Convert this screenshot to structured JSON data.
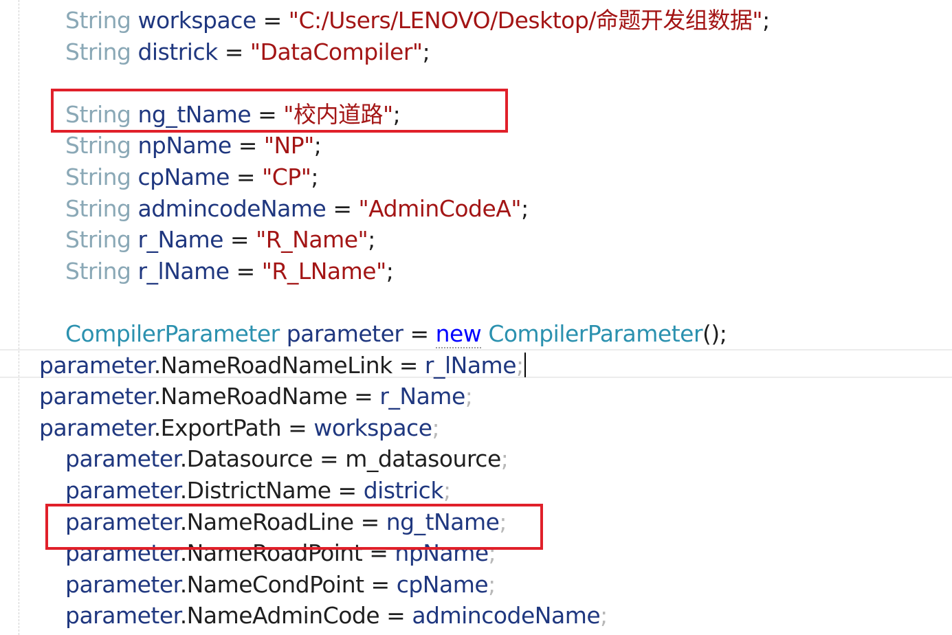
{
  "code": {
    "lines": [
      {
        "indent": "inner",
        "parts": [
          [
            "type",
            "String"
          ],
          [
            "plain",
            " "
          ],
          [
            "ident",
            "workspace"
          ],
          [
            "plain",
            " = "
          ],
          [
            "str",
            "\"C:/Users/LENOVO/Desktop/命题开发组数据\""
          ],
          [
            "plain",
            ";"
          ]
        ]
      },
      {
        "indent": "inner",
        "parts": [
          [
            "type",
            "String"
          ],
          [
            "plain",
            " "
          ],
          [
            "ident",
            "districk"
          ],
          [
            "plain",
            " = "
          ],
          [
            "str",
            "\"DataCompiler\""
          ],
          [
            "plain",
            ";"
          ]
        ]
      },
      {
        "indent": "inner",
        "parts": []
      },
      {
        "indent": "inner",
        "parts": [
          [
            "type",
            "String"
          ],
          [
            "plain",
            " "
          ],
          [
            "ident",
            "ng_tName"
          ],
          [
            "plain",
            " = "
          ],
          [
            "str",
            "\"校内道路\""
          ],
          [
            "plain",
            ";"
          ]
        ]
      },
      {
        "indent": "inner",
        "parts": [
          [
            "type",
            "String"
          ],
          [
            "plain",
            " "
          ],
          [
            "ident",
            "npName"
          ],
          [
            "plain",
            " = "
          ],
          [
            "str",
            "\"NP\""
          ],
          [
            "plain",
            ";"
          ]
        ]
      },
      {
        "indent": "inner",
        "parts": [
          [
            "type",
            "String"
          ],
          [
            "plain",
            " "
          ],
          [
            "ident",
            "cpName"
          ],
          [
            "plain",
            " = "
          ],
          [
            "str",
            "\"CP\""
          ],
          [
            "plain",
            ";"
          ]
        ]
      },
      {
        "indent": "inner",
        "parts": [
          [
            "type",
            "String"
          ],
          [
            "plain",
            " "
          ],
          [
            "ident",
            "admincodeName"
          ],
          [
            "plain",
            " = "
          ],
          [
            "str",
            "\"AdminCodeA\""
          ],
          [
            "plain",
            ";"
          ]
        ]
      },
      {
        "indent": "inner",
        "parts": [
          [
            "type",
            "String"
          ],
          [
            "plain",
            " "
          ],
          [
            "ident",
            "r_Name"
          ],
          [
            "plain",
            " = "
          ],
          [
            "str",
            "\"R_Name\""
          ],
          [
            "plain",
            ";"
          ]
        ]
      },
      {
        "indent": "inner",
        "parts": [
          [
            "type",
            "String"
          ],
          [
            "plain",
            " "
          ],
          [
            "ident",
            "r_lName"
          ],
          [
            "plain",
            " = "
          ],
          [
            "str",
            "\"R_LName\""
          ],
          [
            "plain",
            ";"
          ]
        ]
      },
      {
        "indent": "inner",
        "parts": []
      },
      {
        "indent": "inner",
        "parts": [
          [
            "class",
            "CompilerParameter"
          ],
          [
            "plain",
            " "
          ],
          [
            "ident",
            "parameter"
          ],
          [
            "plain",
            " = "
          ],
          [
            "kw",
            "new"
          ],
          [
            "plain",
            " "
          ],
          [
            "class",
            "CompilerParameter"
          ],
          [
            "plain",
            "();"
          ]
        ]
      },
      {
        "indent": "outer",
        "parts": [
          [
            "ident",
            "parameter"
          ],
          [
            "plain",
            ".NameRoadNameLink = "
          ],
          [
            "ident",
            "r_lName"
          ],
          [
            "semi-dim",
            ";"
          ]
        ],
        "caret": true
      },
      {
        "indent": "outer",
        "parts": [
          [
            "ident",
            "parameter"
          ],
          [
            "plain",
            ".NameRoadName = "
          ],
          [
            "ident",
            "r_Name"
          ],
          [
            "semi-dim",
            ";"
          ]
        ]
      },
      {
        "indent": "outer",
        "parts": [
          [
            "ident",
            "parameter"
          ],
          [
            "plain",
            ".ExportPath = "
          ],
          [
            "ident",
            "workspace"
          ],
          [
            "semi-dim",
            ";"
          ]
        ]
      },
      {
        "indent": "inner",
        "parts": [
          [
            "ident",
            "parameter"
          ],
          [
            "plain",
            ".Datasource = m_datasource"
          ],
          [
            "semi-dim",
            ";"
          ]
        ]
      },
      {
        "indent": "inner",
        "parts": [
          [
            "ident",
            "parameter"
          ],
          [
            "plain",
            ".DistrictName = "
          ],
          [
            "ident",
            "districk"
          ],
          [
            "semi-dim",
            ";"
          ]
        ]
      },
      {
        "indent": "inner",
        "parts": [
          [
            "ident",
            "parameter"
          ],
          [
            "plain",
            ".NameRoadLine = "
          ],
          [
            "ident",
            "ng_tName"
          ],
          [
            "semi-dim",
            ";"
          ]
        ]
      },
      {
        "indent": "inner",
        "parts": [
          [
            "ident",
            "parameter"
          ],
          [
            "plain",
            ".NameRoadPoint = "
          ],
          [
            "ident",
            "npName"
          ],
          [
            "semi-dim",
            ";"
          ]
        ]
      },
      {
        "indent": "inner",
        "parts": [
          [
            "ident",
            "parameter"
          ],
          [
            "plain",
            ".NameCondPoint = "
          ],
          [
            "ident",
            "cpName"
          ],
          [
            "semi-dim",
            ";"
          ]
        ]
      },
      {
        "indent": "inner",
        "parts": [
          [
            "ident",
            "parameter"
          ],
          [
            "plain",
            ".NameAdminCode = "
          ],
          [
            "ident",
            "admincodeName"
          ],
          [
            "semi-dim",
            ";"
          ]
        ]
      }
    ]
  },
  "colors": {
    "type_keyword": "#8aa8b6",
    "class_name": "#2b91af",
    "identifier": "#1f377f",
    "string_literal": "#a31515",
    "keyword": "#0000ff",
    "highlight_box": "#e0202a"
  }
}
